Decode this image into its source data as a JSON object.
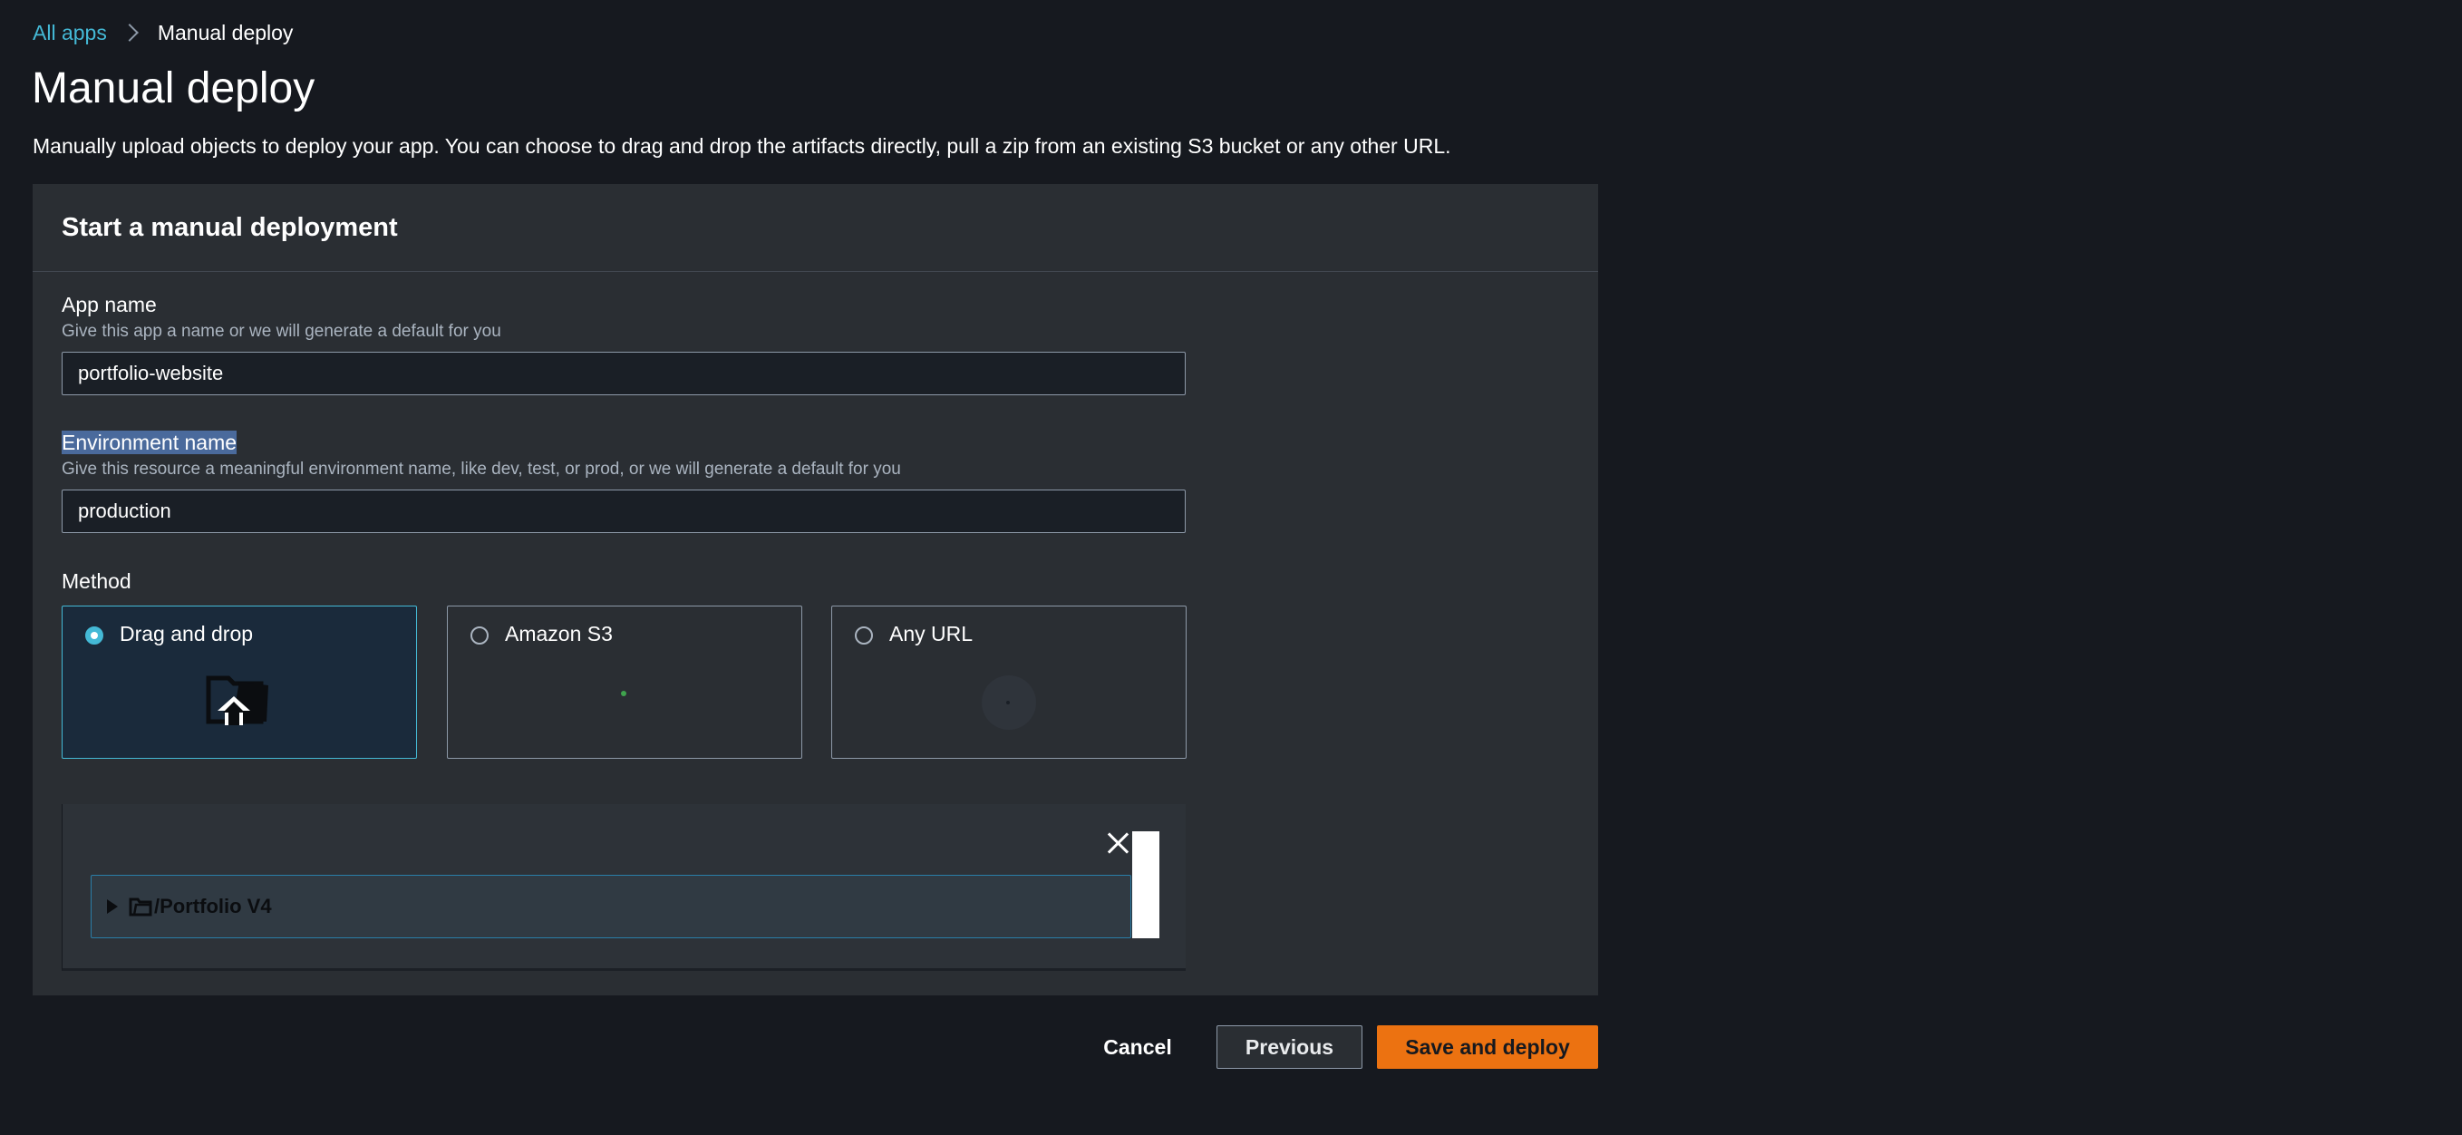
{
  "breadcrumb": {
    "root": "All apps",
    "current": "Manual deploy"
  },
  "page": {
    "title": "Manual deploy",
    "description": "Manually upload objects to deploy your app. You can choose to drag and drop the artifacts directly, pull a zip from an existing S3 bucket or any other URL."
  },
  "form": {
    "header": "Start a manual deployment",
    "app_name": {
      "label": "App name",
      "description": "Give this app a name or we will generate a default for you",
      "value": "portfolio-website"
    },
    "environment_name": {
      "label": "Environment name",
      "description": "Give this resource a meaningful environment name, like dev, test, or prod, or we will generate a default for you",
      "value": "production"
    },
    "method": {
      "label": "Method",
      "selected": "Drag and drop",
      "options": [
        {
          "label": "Drag and drop",
          "icon": "folder-upload-icon"
        },
        {
          "label": "Amazon S3",
          "icon": "s3-icon"
        },
        {
          "label": "Any URL",
          "icon": "url-icon"
        }
      ]
    },
    "upload": {
      "folder_name": "/Portfolio V4"
    }
  },
  "footer": {
    "cancel_label": "Cancel",
    "previous_label": "Previous",
    "save_label": "Save and deploy"
  },
  "colors": {
    "background": "#16191f",
    "panel": "#2a2e33",
    "link": "#44b9d6",
    "primary": "#ec7211",
    "selected_tile": "#1a2a3b"
  }
}
